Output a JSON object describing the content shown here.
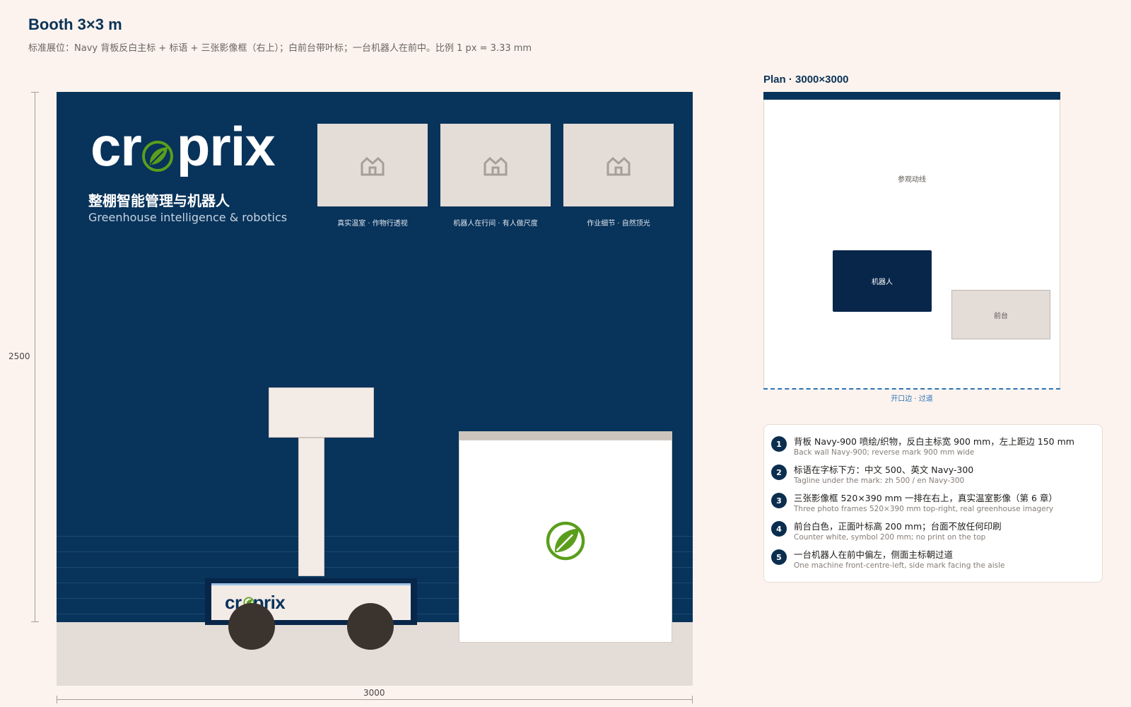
{
  "header": {
    "title": "Booth 3×3 m",
    "subtitle": "标准展位：Navy 背板反白主标 + 标语 + 三张影像框（右上）；白前台带叶标；一台机器人在前中。比例 1 px = 3.33 mm"
  },
  "elevation": {
    "height_label": "2500",
    "width_label": "3000",
    "logo_text_pre": "cr",
    "logo_text_post": "prix",
    "tagline_zh": "整棚智能管理与机器人",
    "tagline_en": "Greenhouse intelligence & robotics",
    "photos": [
      {
        "caption": "真实温室 · 作物行透视",
        "icon": "greenhouse-icon"
      },
      {
        "caption": "机器人在行间 · 有人做尺度",
        "icon": "greenhouse-icon"
      },
      {
        "caption": "作业细节 · 自然顶光",
        "icon": "greenhouse-icon"
      }
    ],
    "robot_logo_pre": "cr",
    "robot_logo_post": "prix"
  },
  "plan": {
    "title": "Plan · 3000×3000",
    "flow_label": "参观动线",
    "robot_label": "机器人",
    "counter_label": "前台",
    "open_side_label": "开口边 · 过道"
  },
  "notes": [
    {
      "num": "1",
      "zh": "背板 Navy-900 喷绘/织物，反白主标宽 900 mm，左上距边 150 mm",
      "en": "Back wall Navy-900; reverse mark 900 mm wide"
    },
    {
      "num": "2",
      "zh": "标语在字标下方：中文 500、英文 Navy-300",
      "en": "Tagline under the mark: zh 500 / en Navy-300"
    },
    {
      "num": "3",
      "zh": "三张影像框 520×390 mm 一排在右上，真实温室影像（第 6 章）",
      "en": "Three photo frames 520×390 mm top-right, real greenhouse imagery"
    },
    {
      "num": "4",
      "zh": "前台白色，正面叶标高 200 mm；台面不放任何印刷",
      "en": "Counter white, symbol 200 mm; no print on the top"
    },
    {
      "num": "5",
      "zh": "一台机器人在前中偏左，侧面主标朝过道",
      "en": "One machine front-centre-left, side mark facing the aisle"
    }
  ],
  "colors": {
    "navy": "#08335a",
    "leaf_green": "#5a9e1c",
    "counter_white": "#ffffff",
    "floor": "#e3dcd7"
  }
}
